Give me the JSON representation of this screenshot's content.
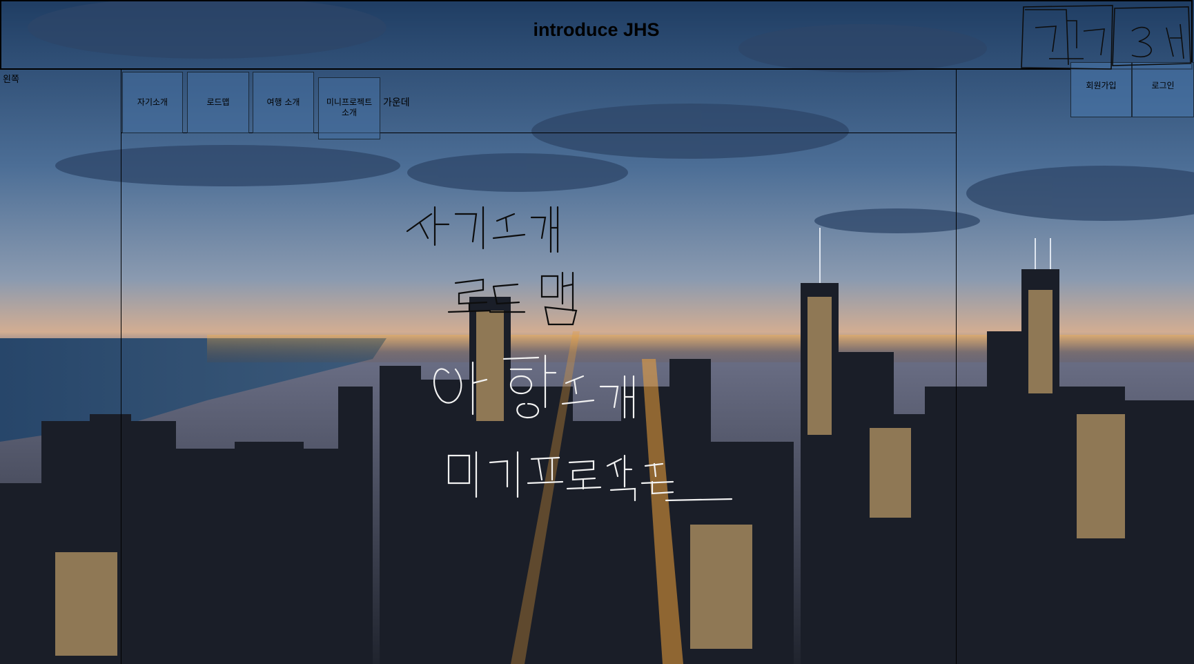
{
  "header": {
    "title": "introduce JHS"
  },
  "left": {
    "label": "왼쪽"
  },
  "center": {
    "label": "가운데"
  },
  "nav": [
    {
      "id": "intro",
      "label": "자기소개"
    },
    {
      "id": "roadmap",
      "label": "로드맵"
    },
    {
      "id": "travel",
      "label": "여행 소개"
    },
    {
      "id": "mini",
      "label": "미니프로젝트\n소개"
    }
  ],
  "auth": {
    "signup_label": "회원가입",
    "login_label": "로그인"
  },
  "handwriting": [
    "자기소개",
    "로드맵",
    "여행소개",
    "미니프로젝트",
    "회원가입",
    "로그인"
  ],
  "colors": {
    "tile": "#4670a0",
    "border": "#000000"
  }
}
